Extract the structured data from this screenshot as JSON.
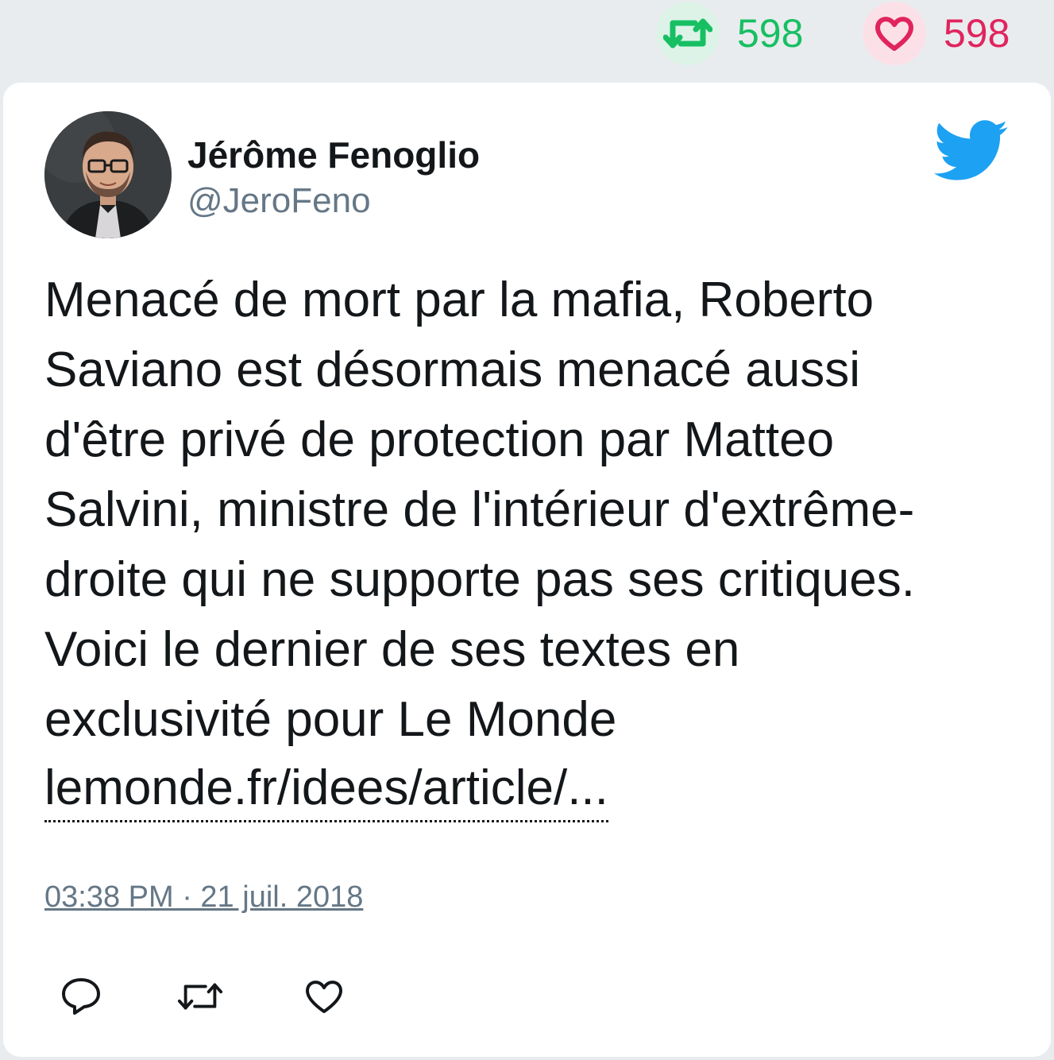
{
  "stats": {
    "retweets": {
      "icon": "retweet-icon",
      "count": "598",
      "color": "#17bf63"
    },
    "likes": {
      "icon": "heart-icon",
      "count": "598",
      "color": "#e0245e"
    }
  },
  "tweet": {
    "author": {
      "name": "Jérôme Fenoglio",
      "handle": "@JeroFeno",
      "avatar_icon": "avatar-photo"
    },
    "logo_icon": "twitter-bird-icon",
    "text": "Menacé de mort par la mafia, Roberto\nSaviano est désormais menacé aussi\nd'être privé de protection par Matteo\nSalvini, ministre de l'intérieur d'extrême-\ndroite qui ne supporte pas ses critiques.\nVoici le dernier de ses textes en\nexclusivité pour Le Monde",
    "link": "lemonde.fr/idees/article/...",
    "timestamp": "03:38 PM · 21 juil. 2018",
    "actions": [
      "reply-icon",
      "retweet-icon",
      "like-icon"
    ]
  },
  "colors": {
    "background": "#e9ecee",
    "card": "#ffffff",
    "text": "#14171a",
    "muted": "#657786",
    "twitter_blue": "#1da1f2"
  }
}
